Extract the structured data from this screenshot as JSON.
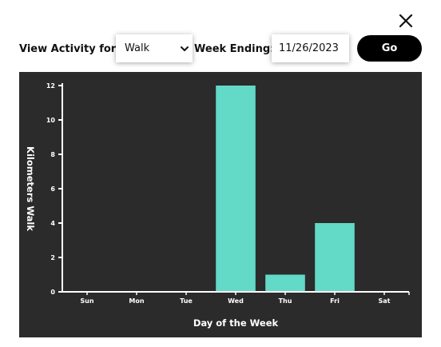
{
  "controls": {
    "activity_label": "View Activity for:",
    "activity_selected": "Walk",
    "week_label": "Week Ending:",
    "week_value": "11/26/2023",
    "go_label": "Go"
  },
  "colors": {
    "bar": "#63d9c7",
    "chart_bg": "#2b2b2b",
    "axis": "#ffffff",
    "button_bg": "#000000"
  },
  "icons": {
    "close": "close-x-icon",
    "dropdown": "chevron-down-icon"
  },
  "chart_data": {
    "type": "bar",
    "categories": [
      "Sun",
      "Mon",
      "Tue",
      "Wed",
      "Thu",
      "Fri",
      "Sat"
    ],
    "values": [
      0,
      0,
      0,
      12,
      1,
      4,
      0
    ],
    "xlabel": "Day of the Week",
    "ylabel": "Kilometers Walk",
    "ylim": [
      0,
      12
    ],
    "yticks": [
      0,
      2,
      4,
      6,
      8,
      10,
      12
    ],
    "grid": false,
    "legend": "none"
  }
}
